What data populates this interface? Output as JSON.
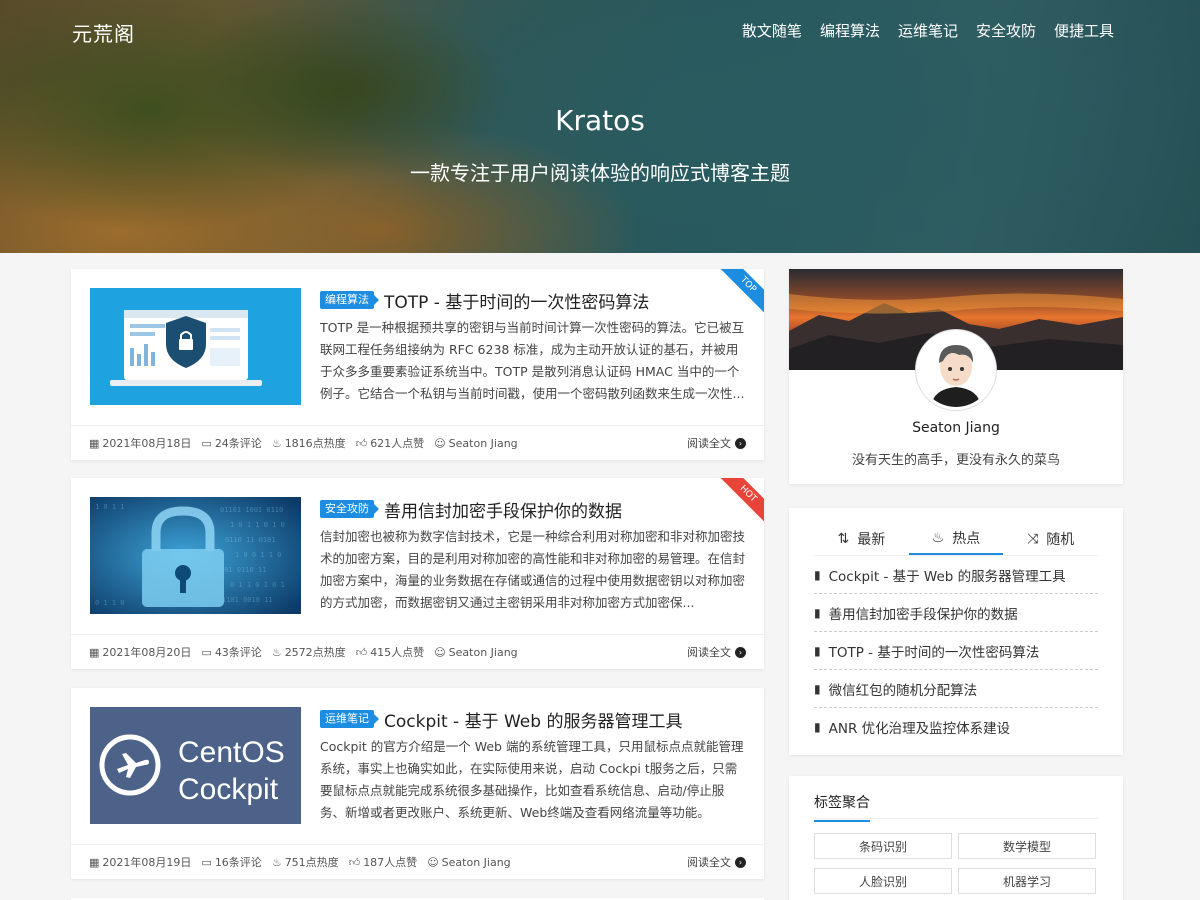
{
  "site": {
    "brand": "元荒阁",
    "nav": [
      "散文随笔",
      "编程算法",
      "运维笔记",
      "安全攻防",
      "便捷工具"
    ],
    "hero_title": "Kratos",
    "hero_subtitle": "一款专注于用户阅读体验的响应式博客主题"
  },
  "posts": [
    {
      "ribbon": "TOP",
      "category": "编程算法",
      "title": "TOTP - 基于时间的一次性密码算法",
      "excerpt": "TOTP 是一种根据预共享的密钥与当前时间计算一次性密码的算法。它已被互联网工程任务组接纳为 RFC 6238 标准，成为主动开放认证的基石，并被用于众多多重要素验证系统当中。TOTP 是散列消息认证码 HMAC 当中的一个例子。它结合一个私钥与当前时间戳，使用一个密码散列函数来生成一次性...",
      "date": "2021年08月18日",
      "comments": "24条评论",
      "heat": "1816点热度",
      "likes": "621人点赞",
      "author": "Seaton Jiang",
      "read_more": "阅读全文"
    },
    {
      "ribbon": "HOT",
      "category": "安全攻防",
      "title": "善用信封加密手段保护你的数据",
      "excerpt": "信封加密也被称为数字信封技术，它是一种综合利用对称加密和非对称加密技术的加密方案，目的是利用对称加密的高性能和非对称加密的易管理。在信封加密方案中，海量的业务数据在存储或通信的过程中使用数据密钥以对称加密的方式加密，而数据密钥又通过主密钥采用非对称加密方式加密保...",
      "date": "2021年08月20日",
      "comments": "43条评论",
      "heat": "2572点热度",
      "likes": "415人点赞",
      "author": "Seaton Jiang",
      "read_more": "阅读全文"
    },
    {
      "ribbon": "",
      "category": "运维笔记",
      "title": "Cockpit - 基于 Web 的服务器管理工具",
      "excerpt": "Cockpit 的官方介绍是一个 Web 端的系统管理工具，只用鼠标点点就能管理系统，事实上也确实如此，在实际使用来说，启动 Cockpi t服务之后，只需要鼠标点点就能完成系统很多基础操作，比如查看系统信息、启动/停止服务、新增或者更改账户、系统更新、Web终端及查看网络流量等功能。",
      "thumb_line1": "CentOS",
      "thumb_line2": "Cockpit",
      "date": "2021年08月19日",
      "comments": "16条评论",
      "heat": "751点热度",
      "likes": "187人点赞",
      "author": "Seaton Jiang",
      "read_more": "阅读全文"
    }
  ],
  "profile": {
    "name": "Seaton Jiang",
    "bio": "没有天生的高手，更没有永久的菜鸟"
  },
  "hot_widget": {
    "tabs": [
      "最新",
      "热点",
      "随机"
    ],
    "active_tab": "热点",
    "items": [
      "Cockpit - 基于 Web 的服务器管理工具",
      "善用信封加密手段保护你的数据",
      "TOTP - 基于时间的一次性密码算法",
      "微信红包的随机分配算法",
      "ANR 优化治理及监控体系建设"
    ]
  },
  "tags_widget": {
    "title": "标签聚合",
    "tags": [
      "条码识别",
      "数学模型",
      "人脸识别",
      "机器学习"
    ]
  },
  "colors": {
    "accent": "#1c8de0",
    "hot": "#e8443a",
    "cockpit_bg": "#4c6289"
  }
}
